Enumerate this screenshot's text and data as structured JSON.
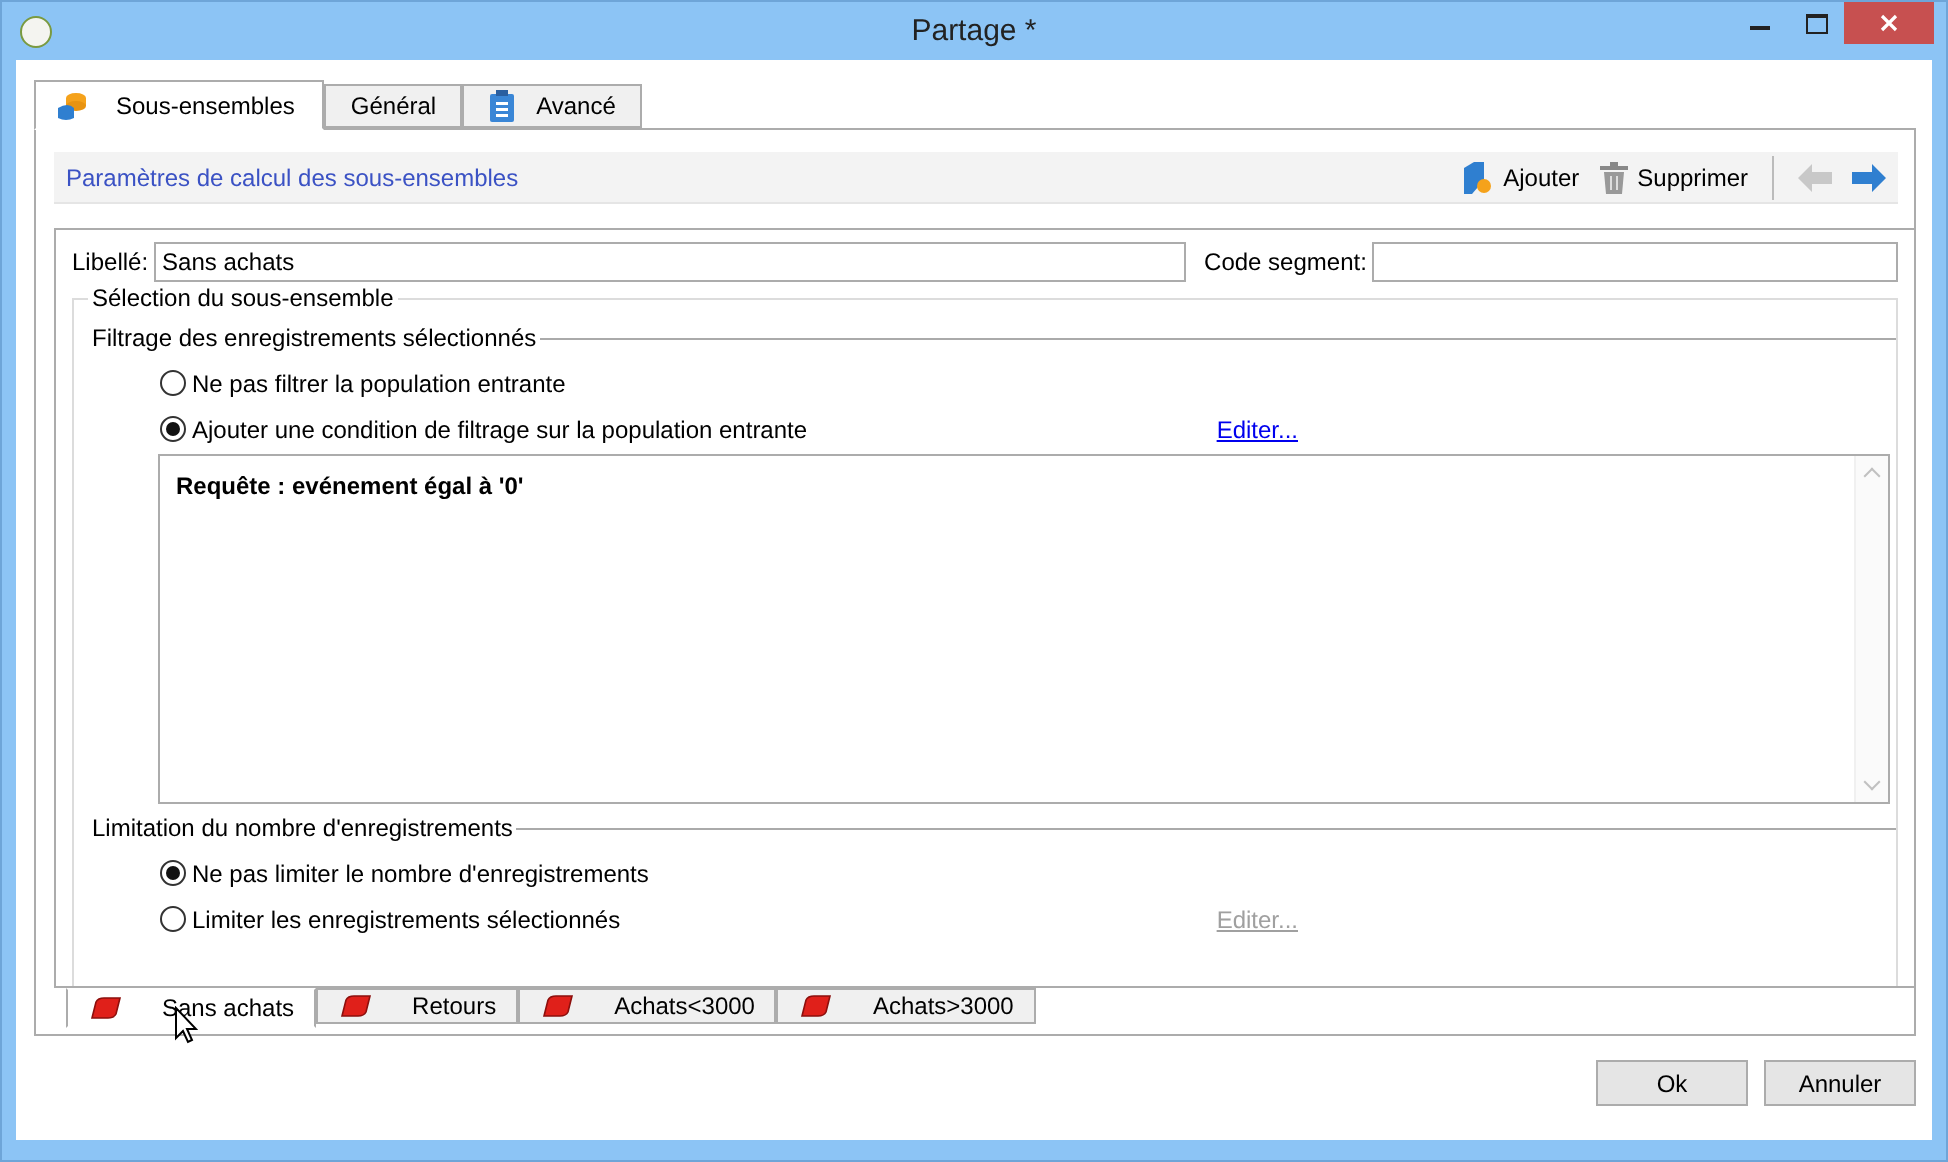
{
  "window": {
    "title": "Partage *"
  },
  "tabs": [
    {
      "label": "Sous-ensembles",
      "selected": true
    },
    {
      "label": "Général",
      "selected": false
    },
    {
      "label": "Avancé",
      "selected": false
    }
  ],
  "header": {
    "title": "Paramètres de calcul des sous-ensembles",
    "actions": [
      {
        "label": "Ajouter"
      },
      {
        "label": "Supprimer"
      }
    ],
    "nav": [
      {
        "disabled": true
      },
      {
        "disabled": false
      }
    ]
  },
  "fields": [
    {
      "label": "Libellé:",
      "value": "Sans achats"
    },
    {
      "label": "Code segment:"
    }
  ],
  "selection": {
    "title": "Sélection du sous-ensemble",
    "filter": {
      "title": "Filtrage des enregistrements sélectionnés",
      "options": [
        {
          "label": "Ne pas filtrer la population entrante",
          "selected": false
        },
        {
          "label": "Ajouter une condition de filtrage sur la population entrante",
          "selected": true
        }
      ],
      "edit_link": {
        "label": "Editer...",
        "disabled": false
      },
      "query": "Requête : evénement égal à '0'"
    },
    "limit": {
      "title": "Limitation du nombre d'enregistrements",
      "options": [
        {
          "label": "Ne pas limiter le nombre d'enregistrements",
          "selected": true
        },
        {
          "label": "Limiter les enregistrements sélectionnés",
          "selected": false
        }
      ],
      "edit_link": {
        "label": "Editer...",
        "disabled": true
      }
    }
  },
  "segment_tabs": [
    {
      "label": "Sans achats",
      "selected": true
    },
    {
      "label": "Retours",
      "selected": false
    },
    {
      "label": "Achats<3000",
      "selected": false
    },
    {
      "label": "Achats>3000",
      "selected": false
    }
  ],
  "buttons": [
    {
      "label": "Ok"
    },
    {
      "label": "Annuler"
    }
  ]
}
